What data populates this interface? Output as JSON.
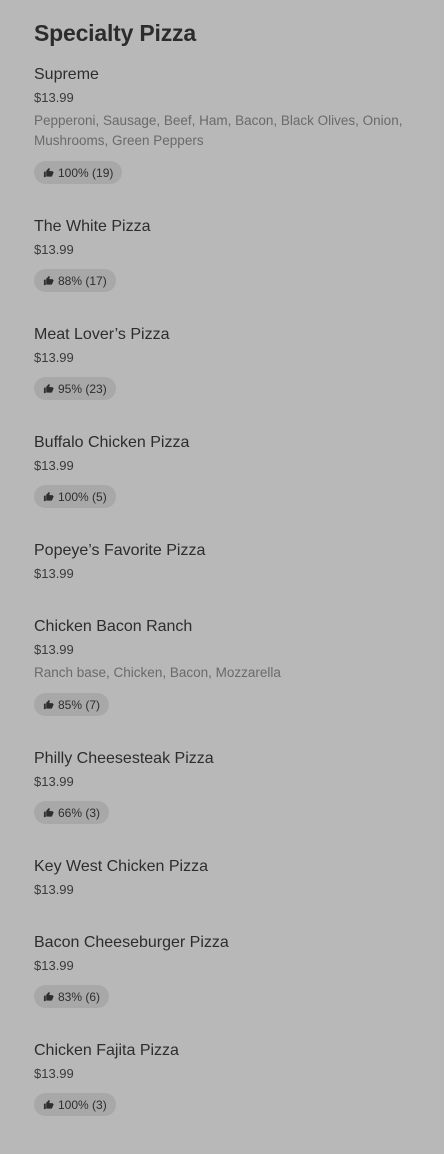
{
  "section": {
    "title": "Specialty Pizza"
  },
  "items": [
    {
      "name": "Supreme",
      "price": "$13.99",
      "description": "Pepperoni, Sausage, Beef, Ham, Bacon, Black Olives, Onion, Mushrooms, Green Peppers",
      "rating": "100% (19)"
    },
    {
      "name": "The White Pizza",
      "price": "$13.99",
      "rating": "88% (17)"
    },
    {
      "name": "Meat Lover’s Pizza",
      "price": "$13.99",
      "rating": "95% (23)"
    },
    {
      "name": "Buffalo Chicken Pizza",
      "price": "$13.99",
      "rating": "100% (5)"
    },
    {
      "name": "Popeye’s Favorite Pizza",
      "price": "$13.99"
    },
    {
      "name": "Chicken Bacon Ranch",
      "price": "$13.99",
      "description": "Ranch base, Chicken, Bacon, Mozzarella",
      "rating": "85% (7)"
    },
    {
      "name": "Philly Cheesesteak Pizza",
      "price": "$13.99",
      "rating": "66% (3)"
    },
    {
      "name": "Key West Chicken Pizza",
      "price": "$13.99"
    },
    {
      "name": "Bacon Cheeseburger Pizza",
      "price": "$13.99",
      "rating": "83% (6)"
    },
    {
      "name": "Chicken Fajita Pizza",
      "price": "$13.99",
      "rating": "100% (3)"
    }
  ],
  "icons": {
    "rating": "thumbs-up-icon"
  }
}
